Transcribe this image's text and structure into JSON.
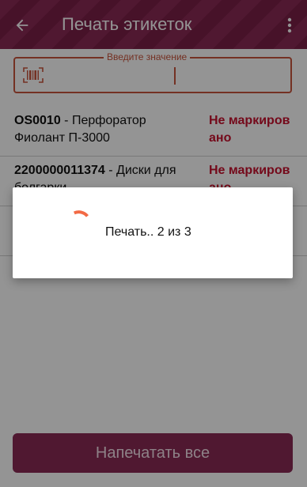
{
  "app": {
    "title": "Печать этикеток",
    "back_icon": "arrow-back-icon",
    "menu_icon": "more-vert-icon",
    "bar_color": "#8b2a55"
  },
  "input": {
    "label": "Введите значение",
    "value": "",
    "icon": "barcode-icon",
    "accent": "#c8553d"
  },
  "items": [
    {
      "code": "OS0010",
      "separator": " - ",
      "name": "Перфоратор Фиолант П-3000",
      "status": "Не маркировано"
    },
    {
      "code": "2200000011374",
      "separator": " - ",
      "name": "Диски для болгарки",
      "status": "Не маркировано"
    }
  ],
  "footer": {
    "print_all_label": "Напечатать все"
  },
  "dialog": {
    "message": "Печать.. 2 из 3",
    "spinner_color": "#f26a45"
  }
}
